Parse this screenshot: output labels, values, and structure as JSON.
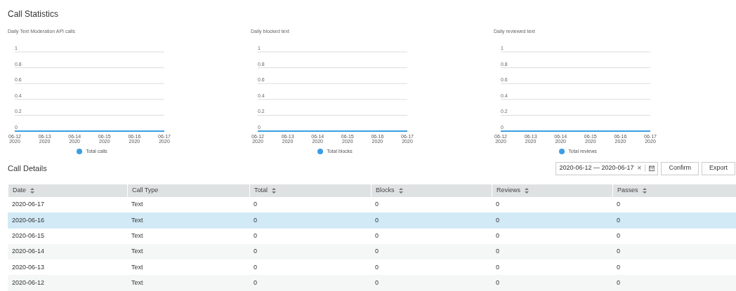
{
  "title": "Call Statistics",
  "charts": [
    {
      "chart_data": {
        "type": "line",
        "title": "Daily Text Moderation API calls",
        "categories": [
          "06-12 2020",
          "06-13 2020",
          "06-14 2020",
          "06-15 2020",
          "06-16 2020",
          "06-17 2020"
        ],
        "series": [
          {
            "name": "Total calls",
            "color": "#3a9ee4",
            "values": [
              0,
              0,
              0,
              0,
              0,
              0
            ]
          }
        ],
        "ylim": [
          0,
          1
        ],
        "yticks": [
          0,
          0.2,
          0.4,
          0.6,
          0.8,
          1
        ],
        "grid": true
      }
    },
    {
      "chart_data": {
        "type": "line",
        "title": "Daily blocked text",
        "categories": [
          "06-12 2020",
          "06-13 2020",
          "06-14 2020",
          "06-15 2020",
          "06-16 2020",
          "06-17 2020"
        ],
        "series": [
          {
            "name": "Total blocks",
            "color": "#3a9ee4",
            "values": [
              0,
              0,
              0,
              0,
              0,
              0
            ]
          }
        ],
        "ylim": [
          0,
          1
        ],
        "yticks": [
          0,
          0.2,
          0.4,
          0.6,
          0.8,
          1
        ],
        "grid": true
      }
    },
    {
      "chart_data": {
        "type": "line",
        "title": "Daily reviewed text",
        "categories": [
          "06-12 2020",
          "06-13 2020",
          "06-14 2020",
          "06-15 2020",
          "06-16 2020",
          "06-17 2020"
        ],
        "series": [
          {
            "name": "Total reviews",
            "color": "#3a9ee4",
            "values": [
              0,
              0,
              0,
              0,
              0,
              0
            ]
          }
        ],
        "ylim": [
          0,
          1
        ],
        "yticks": [
          0,
          0.2,
          0.4,
          0.6,
          0.8,
          1
        ],
        "grid": true
      }
    }
  ],
  "details": {
    "title": "Call Details",
    "date_range": "2020-06-12 — 2020-06-17",
    "clear": "×",
    "buttons": [
      "Confirm",
      "Export"
    ],
    "columns": [
      {
        "label": "Date",
        "sortable": true
      },
      {
        "label": "Call Type",
        "sortable": false
      },
      {
        "label": "Total",
        "sortable": true
      },
      {
        "label": "Blocks",
        "sortable": true
      },
      {
        "label": "Reviews",
        "sortable": true
      },
      {
        "label": "Passes",
        "sortable": true
      }
    ],
    "rows": [
      {
        "selected": false,
        "cells": [
          "2020-06-17",
          "Text",
          "0",
          "0",
          "0",
          "0"
        ]
      },
      {
        "selected": true,
        "cells": [
          "2020-06-16",
          "Text",
          "0",
          "0",
          "0",
          "0"
        ]
      },
      {
        "selected": false,
        "cells": [
          "2020-06-15",
          "Text",
          "0",
          "0",
          "0",
          "0"
        ]
      },
      {
        "selected": false,
        "cells": [
          "2020-06-14",
          "Text",
          "0",
          "0",
          "0",
          "0"
        ]
      },
      {
        "selected": false,
        "cells": [
          "2020-06-13",
          "Text",
          "0",
          "0",
          "0",
          "0"
        ]
      },
      {
        "selected": false,
        "cells": [
          "2020-06-12",
          "Text",
          "0",
          "0",
          "0",
          "0"
        ]
      }
    ]
  }
}
